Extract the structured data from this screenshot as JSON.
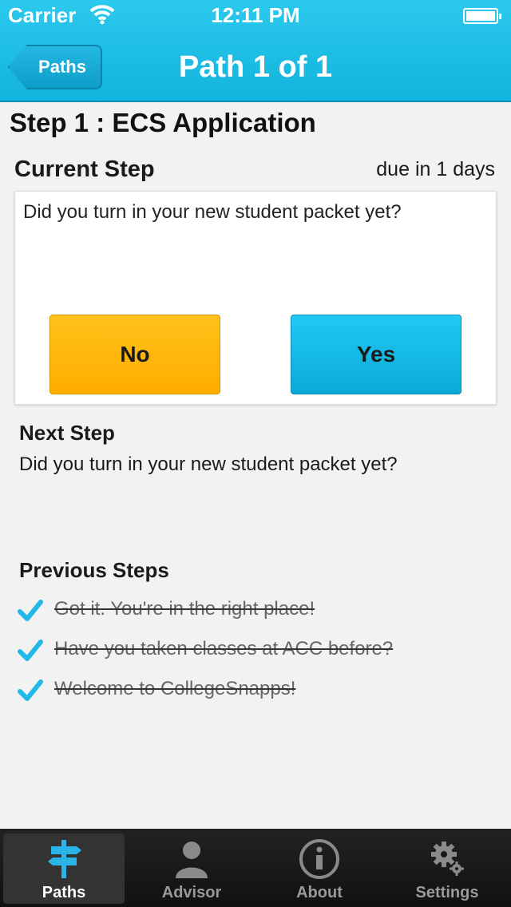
{
  "status_bar": {
    "carrier": "Carrier",
    "time": "12:11 PM"
  },
  "nav": {
    "back_label": "Paths",
    "title": "Path 1 of 1"
  },
  "step_title": "Step 1 : ECS Application",
  "current": {
    "label": "Current Step",
    "due": "due in 1 days",
    "question": "Did you turn in your new student packet yet?",
    "no_label": "No",
    "yes_label": "Yes"
  },
  "next": {
    "label": "Next Step",
    "text": "Did you turn in your new student packet yet?"
  },
  "previous": {
    "label": "Previous Steps",
    "items": [
      {
        "text": "Got it. You're in the right place!",
        "completed": true
      },
      {
        "text": "Have you taken classes at ACC before?",
        "completed": true
      },
      {
        "text": "Welcome to CollegeSnapps!",
        "completed": true
      }
    ]
  },
  "tabs": [
    {
      "label": "Paths",
      "icon": "signpost-icon",
      "active": true
    },
    {
      "label": "Advisor",
      "icon": "person-icon",
      "active": false
    },
    {
      "label": "About",
      "icon": "info-icon",
      "active": false
    },
    {
      "label": "Settings",
      "icon": "gear-icon",
      "active": false
    }
  ],
  "colors": {
    "nav_blue": "#1bbde6",
    "no_button": "#ffb800",
    "yes_button": "#12b8e6",
    "checkmark": "#22b8e8"
  }
}
